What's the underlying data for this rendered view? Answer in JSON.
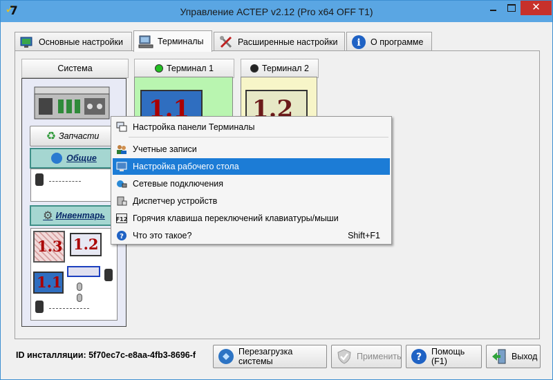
{
  "window": {
    "title": "Управление АСТЕР v2.12 (Pro x64 OFF T1)",
    "close_glyph": "✕"
  },
  "tabs": [
    {
      "label": "Основные настройки",
      "icon": "monitor-settings-icon"
    },
    {
      "label": "Терминалы",
      "icon": "computer-icon",
      "active": true
    },
    {
      "label": "Расширенные настройки",
      "icon": "tools-icon"
    },
    {
      "label": "О программе",
      "icon": "info-icon"
    }
  ],
  "system": {
    "header": "Система",
    "spares_label": "Запчасти",
    "general_label": "Общие",
    "inventory_label": "Инвентарь",
    "inventory_monitors": [
      "1.3",
      "1.2",
      "1.1"
    ]
  },
  "terminals": [
    {
      "header": "Терминал 1",
      "status_color": "#22c022",
      "number": "1.1"
    },
    {
      "header": "Терминал 2",
      "status_color": "#222222",
      "number": "1.2"
    }
  ],
  "context_menu": {
    "items": [
      {
        "label": "Настройка панели Терминалы",
        "icon": "panel-settings-icon"
      },
      {
        "label": "Учетные записи",
        "icon": "users-icon"
      },
      {
        "label": "Настройка рабочего стола",
        "icon": "desktop-icon",
        "highlighted": true
      },
      {
        "label": "Сетевые подключения",
        "icon": "network-icon"
      },
      {
        "label": "Диспетчер устройств",
        "icon": "device-manager-icon"
      },
      {
        "label": "Горячия клавиша переключений клавиатуры/мыши",
        "icon": "f12-key-icon"
      },
      {
        "label": "Что это такое?",
        "icon": "help-icon",
        "shortcut": "Shift+F1"
      }
    ]
  },
  "footer": {
    "install_id": "ID инсталляции: 5f70ec7c-e8aa-4fb3-8696-f",
    "buttons": {
      "reboot": "Перезагрузка системы",
      "apply": "Применить",
      "help": "Помощь (F1)",
      "exit": "Выход"
    }
  },
  "colors": {
    "titlebar": "#5aa6e3",
    "close_button": "#c7312b",
    "highlight": "#1c7cd6",
    "section": "#a5d6d1",
    "terminal1_bg": "#b9f5b0",
    "terminal2_bg": "#f7f5c8"
  }
}
